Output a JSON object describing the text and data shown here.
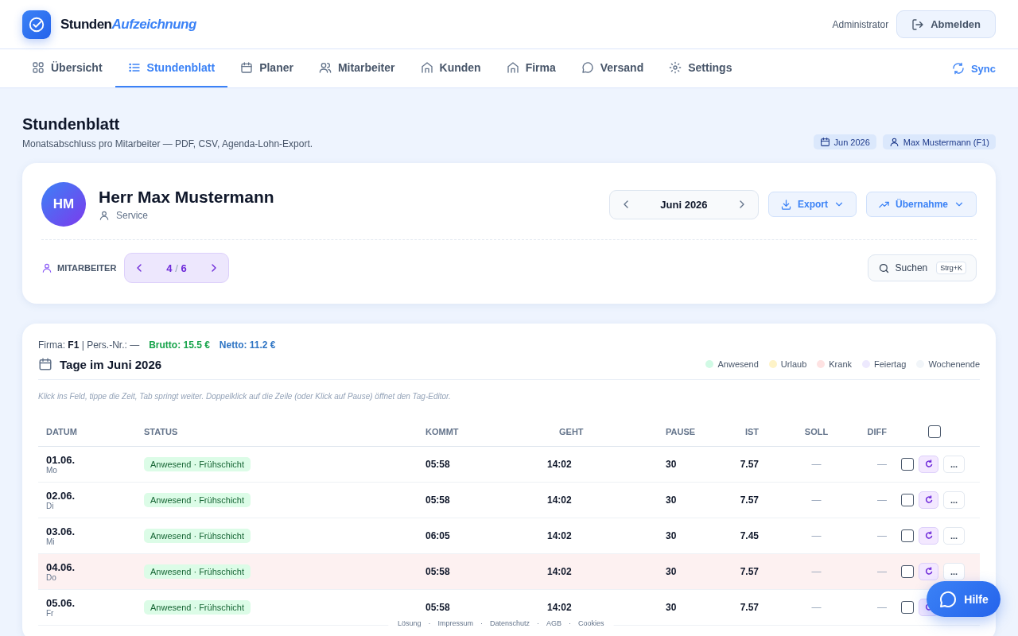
{
  "brand": {
    "part1": "Stunden",
    "part2": "Aufzeichnung"
  },
  "user": {
    "role": "Administrator",
    "logout": "Abmelden"
  },
  "nav": {
    "tabs": [
      {
        "label": "Übersicht",
        "selected": false
      },
      {
        "label": "Stundenblatt",
        "selected": true
      },
      {
        "label": "Planer",
        "selected": false
      },
      {
        "label": "Mitarbeiter",
        "selected": false
      },
      {
        "label": "Kunden",
        "selected": false
      },
      {
        "label": "Firma",
        "selected": false
      },
      {
        "label": "Versand",
        "selected": false
      },
      {
        "label": "Settings",
        "selected": false
      }
    ],
    "sync": "Sync"
  },
  "page": {
    "title": "Stundenblatt",
    "subtitle": "Monatsabschluss pro Mitarbeiter — PDF, CSV, Agenda-Lohn-Export.",
    "chips": [
      "Jun 2026",
      "Max Mustermann (F1)"
    ]
  },
  "employee": {
    "initials": "HM",
    "name": "Herr Max Mustermann",
    "department": "Service",
    "month": "Juni 2026",
    "export": "Export",
    "takeover": "Übernahme",
    "nav_label": "MITARBEITER",
    "index": "4",
    "separator": "/",
    "total": "6",
    "search": "Suchen",
    "shortcut": "Strg+K"
  },
  "summary": {
    "firma_label": "Firma:",
    "firma": "F1",
    "pers": "| Pers.-Nr.: —",
    "brutto": "Brutto: 15.5 €",
    "netto": "Netto: 11.2 €"
  },
  "days": {
    "title": "Tage im Juni 2026",
    "legend": [
      {
        "label": "Anwesend",
        "color": "#d1fae5"
      },
      {
        "label": "Urlaub",
        "color": "#fef3c7"
      },
      {
        "label": "Krank",
        "color": "#fee2e2"
      },
      {
        "label": "Feiertag",
        "color": "#ede9fe"
      },
      {
        "label": "Wochenende",
        "color": "#f1f5f9"
      }
    ],
    "hint": "Klick ins Feld, tippe die Zeit, Tab springt weiter. Doppelklick auf die Zeile (oder Klick auf Pause) öffnet den Tag-Editor.",
    "columns": [
      "DATUM",
      "STATUS",
      "KOMMT",
      "GEHT",
      "PAUSE",
      "IST",
      "SOLL",
      "DIFF"
    ],
    "select_all": {
      "checked": false
    },
    "rows": [
      {
        "date": "01.06.",
        "weekday": "Mo",
        "status": "Anwesend · Frühschicht",
        "kind": "present",
        "kommt": "05:58",
        "geht": "14:02",
        "pause": "30",
        "ist": "7.57",
        "soll": "—",
        "diff": "—",
        "checked": false,
        "highlighted": false,
        "more": "..."
      },
      {
        "date": "02.06.",
        "weekday": "Di",
        "status": "Anwesend · Frühschicht",
        "kind": "present",
        "kommt": "05:58",
        "geht": "14:02",
        "pause": "30",
        "ist": "7.57",
        "soll": "—",
        "diff": "—",
        "checked": false,
        "highlighted": false,
        "more": "..."
      },
      {
        "date": "03.06.",
        "weekday": "Mi",
        "status": "Anwesend · Frühschicht",
        "kind": "present",
        "kommt": "06:05",
        "geht": "14:02",
        "pause": "30",
        "ist": "7.45",
        "soll": "—",
        "diff": "—",
        "checked": false,
        "highlighted": false,
        "more": "..."
      },
      {
        "date": "04.06.",
        "weekday": "Do",
        "status": "Anwesend · Frühschicht",
        "kind": "present",
        "kommt": "05:58",
        "geht": "14:02",
        "pause": "30",
        "ist": "7.57",
        "soll": "—",
        "diff": "—",
        "checked": false,
        "highlighted": true,
        "more": "..."
      },
      {
        "date": "05.06.",
        "weekday": "Fr",
        "status": "Anwesend · Frühschicht",
        "kind": "present",
        "kommt": "05:58",
        "geht": "14:02",
        "pause": "30",
        "ist": "7.57",
        "soll": "—",
        "diff": "—",
        "checked": false,
        "highlighted": false
      }
    ]
  },
  "footer": {
    "links": [
      "Lösung",
      "Impressum",
      "Datenschutz",
      "AGB",
      "Cookies"
    ],
    "separator": "·"
  },
  "help": "Hilfe"
}
